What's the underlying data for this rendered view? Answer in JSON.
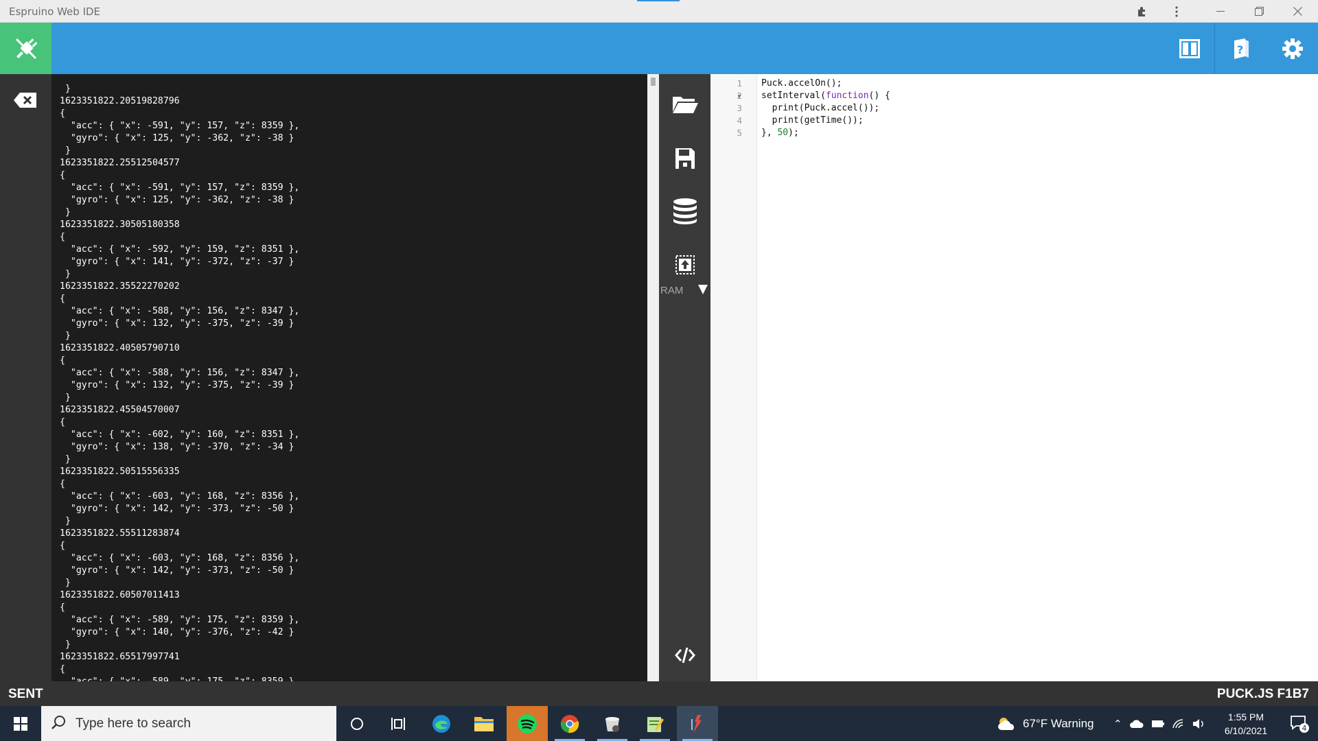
{
  "window": {
    "title": "Espruino Web IDE"
  },
  "terminal": {
    "lines": [
      " }",
      "1623351822.20519828796",
      "{",
      "  \"acc\": { \"x\": -591, \"y\": 157, \"z\": 8359 },",
      "  \"gyro\": { \"x\": 125, \"y\": -362, \"z\": -38 }",
      " }",
      "1623351822.25512504577",
      "{",
      "  \"acc\": { \"x\": -591, \"y\": 157, \"z\": 8359 },",
      "  \"gyro\": { \"x\": 125, \"y\": -362, \"z\": -38 }",
      " }",
      "1623351822.30505180358",
      "{",
      "  \"acc\": { \"x\": -592, \"y\": 159, \"z\": 8351 },",
      "  \"gyro\": { \"x\": 141, \"y\": -372, \"z\": -37 }",
      " }",
      "1623351822.35522270202",
      "{",
      "  \"acc\": { \"x\": -588, \"y\": 156, \"z\": 8347 },",
      "  \"gyro\": { \"x\": 132, \"y\": -375, \"z\": -39 }",
      " }",
      "1623351822.40505790710",
      "{",
      "  \"acc\": { \"x\": -588, \"y\": 156, \"z\": 8347 },",
      "  \"gyro\": { \"x\": 132, \"y\": -375, \"z\": -39 }",
      " }",
      "1623351822.45504570007",
      "{",
      "  \"acc\": { \"x\": -602, \"y\": 160, \"z\": 8351 },",
      "  \"gyro\": { \"x\": 138, \"y\": -370, \"z\": -34 }",
      " }",
      "1623351822.50515556335",
      "{",
      "  \"acc\": { \"x\": -603, \"y\": 168, \"z\": 8356 },",
      "  \"gyro\": { \"x\": 142, \"y\": -373, \"z\": -50 }",
      " }",
      "1623351822.55511283874",
      "{",
      "  \"acc\": { \"x\": -603, \"y\": 168, \"z\": 8356 },",
      "  \"gyro\": { \"x\": 142, \"y\": -373, \"z\": -50 }",
      " }",
      "1623351822.60507011413",
      "{",
      "  \"acc\": { \"x\": -589, \"y\": 175, \"z\": 8359 },",
      "  \"gyro\": { \"x\": 140, \"y\": -376, \"z\": -42 }",
      " }",
      "1623351822.65517997741",
      "{",
      "  \"acc\": { \"x\": -589, \"y\": 175, \"z\": 8359 }"
    ]
  },
  "midcol": {
    "ram_label": "RAM",
    "icons": [
      "open-folder-icon",
      "save-icon",
      "storage-icon",
      "send-to-ram-icon",
      "code-view-icon"
    ]
  },
  "editor": {
    "line_numbers": [
      "1",
      "2",
      "3",
      "4",
      "5"
    ],
    "code": [
      [
        {
          "t": "Puck.accelOn();",
          "c": ""
        }
      ],
      [
        {
          "t": "setInterval(",
          "c": ""
        },
        {
          "t": "function",
          "c": "kw"
        },
        {
          "t": "() {",
          "c": ""
        }
      ],
      [
        {
          "t": "  print(Puck.accel());",
          "c": ""
        }
      ],
      [
        {
          "t": "  print(getTime());",
          "c": ""
        }
      ],
      [
        {
          "t": "}, ",
          "c": ""
        },
        {
          "t": "50",
          "c": "num"
        },
        {
          "t": ");",
          "c": ""
        }
      ]
    ]
  },
  "status": {
    "left": "SENT",
    "right": "PUCK.JS F1B7"
  },
  "taskbar": {
    "search_placeholder": "Type here to search",
    "weather": "67°F  Warning",
    "time": "1:55 PM",
    "date": "6/10/2021",
    "notification_count": "4"
  },
  "colors": {
    "toolbar": "#3498db",
    "connect": "#47c47a",
    "terminal_bg": "#1d1d1d"
  }
}
